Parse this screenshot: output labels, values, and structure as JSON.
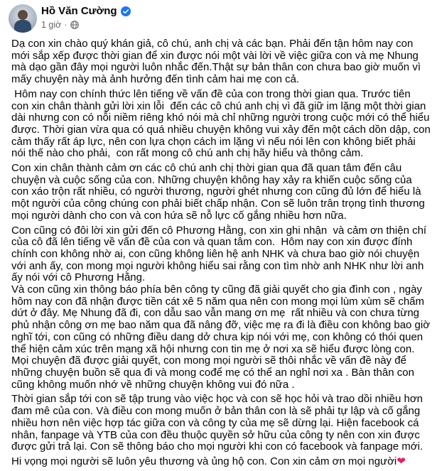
{
  "author": {
    "name": "Hồ Văn Cường",
    "time": "1 giờ",
    "dot": "·"
  },
  "post": {
    "paragraphs": [
      "Dạ con xin chào quý khán giả, cô chú, anh chị và các bạn. Phải đến tận hôm nay con mới sắp xếp được thời gian để xin được nói một vài lời về việc giữa con và mẹ Nhung mà dạo gần đây mọi người luôn nhắc đến.Thật sự bản thân con chưa bao giờ muốn vì mấy chuyện này mà ảnh hưởng đến tình cảm hai mẹ con cả.",
      " Hôm nay con chính thức lên tiếng về vấn đề của con trong thời gian qua. Trước tiên con xin chân thành gửi lời xin lỗi  đến các cô chú anh chị vì đã giữ im lặng một thời gian dài nhưng con có nỗi niềm riêng khó nói mà chỉ những người trong cuộc mới có thể hiểu được. Thời gian vừa qua có quá nhiều chuyện không vui xảy đến một cách dồn dập, con cảm thấy rất áp lực, nên con lựa chọn cách im lặng vì nếu nói lên con không biết phải nói thế nào cho phải,  con rất mong cô chú anh chị hãy hiểu và thông cảm.",
      "Con xin chân thành cảm ơn các cô chú anh chị thời gian qua đã quan tâm đến câu chuyện và cuộc sống của con. Những chuyện không hay xảy ra khiến cuộc sống của con xáo trộn rất nhiều, có người thương, người ghét nhưng con cũng đủ lớn để hiểu là một người của công chúng con phải biết chấp nhận. Con sẽ luôn trân trọng tình thương mọi người dành cho con và con hứa sẽ nỗ lực cố gắng nhiều hơn nữa.",
      "Con cũng có đôi lời xin gửi đến cô Phương Hằng, con xin ghi nhận  và cảm ơn thiện chí của cô đã lên tiếng về vấn đề của con và quan tâm con.  Hôm nay con xin được đính chính con không nhờ ai, con cũng không liên hệ anh NHK và chưa bao giờ nói chuyện với anh ấy, con mong mọi người không hiểu sai rằng con tìm nhờ anh NHK như lời anh ấy nói với cô Phương Hằng.\nVà con cũng xin thông báo phía bên công ty cũng đã giải quyết cho gia đình con , ngày hôm nay con đã nhận được tiền cát xê 5 năm qua nên con mong mọi lùm xùm sẽ chấm dứt ở đây. Mẹ Nhung đã đi, con dẫu sao vẫn mang ơn mẹ  rất nhiều và con chưa từng phủ nhận công ơn mẹ bao năm qua đã nâng đỡ, việc mẹ ra đi là điều con không bao giờ nghĩ tới, con cũng có những điều dang dở chưa kịp nói với mẹ, con không có thói quen thể hiện cảm xúc trên mạng xã hội nhưng con tin mẹ ở nơi xa sẽ hiểu được lòng con. Mọi chuyện đã được giải quyết, con mong mọi người sẽ thôi nhắc về vấn đề này để những chuyện buồn sẽ qua đi và mong cođể mẹ có thể an nghỉ nơi xa . Bàn thân con cũng không muốn nhớ về những chuyện không vui đó nữa .",
      "Thời gian sắp tới con sẽ tập trung vào việc học và con sẽ học hỏi và trao dồi nhiều hơn đam mê của con. Và điều con mong muốn ở bản thân con là sẽ phải tự lập và cố gắng nhiều hơn nên việc hợp tác giữa con và công ty của mẹ sẽ dừng lại. Hiện facebook cá nhân, fanpage và YTB của con đều thuộc quyền sở hữu của công ty nên con xin được được gửi trả lại. Con sẽ thông báo cho mọi người khi con có facebook và fanpage mới."
    ],
    "closing": "Hi vọng mọi người sẽ luôn yêu thương và ủng hộ con. Con xin cảm ơn mọi người",
    "closing_emoji": "❤"
  },
  "colors": {
    "verified_blue": "#1877f2",
    "meta_gray": "#65676b",
    "text": "#050505",
    "heart": "#e0245e"
  },
  "icons": [
    "verified-badge-icon",
    "globe-icon",
    "heart-icon"
  ]
}
